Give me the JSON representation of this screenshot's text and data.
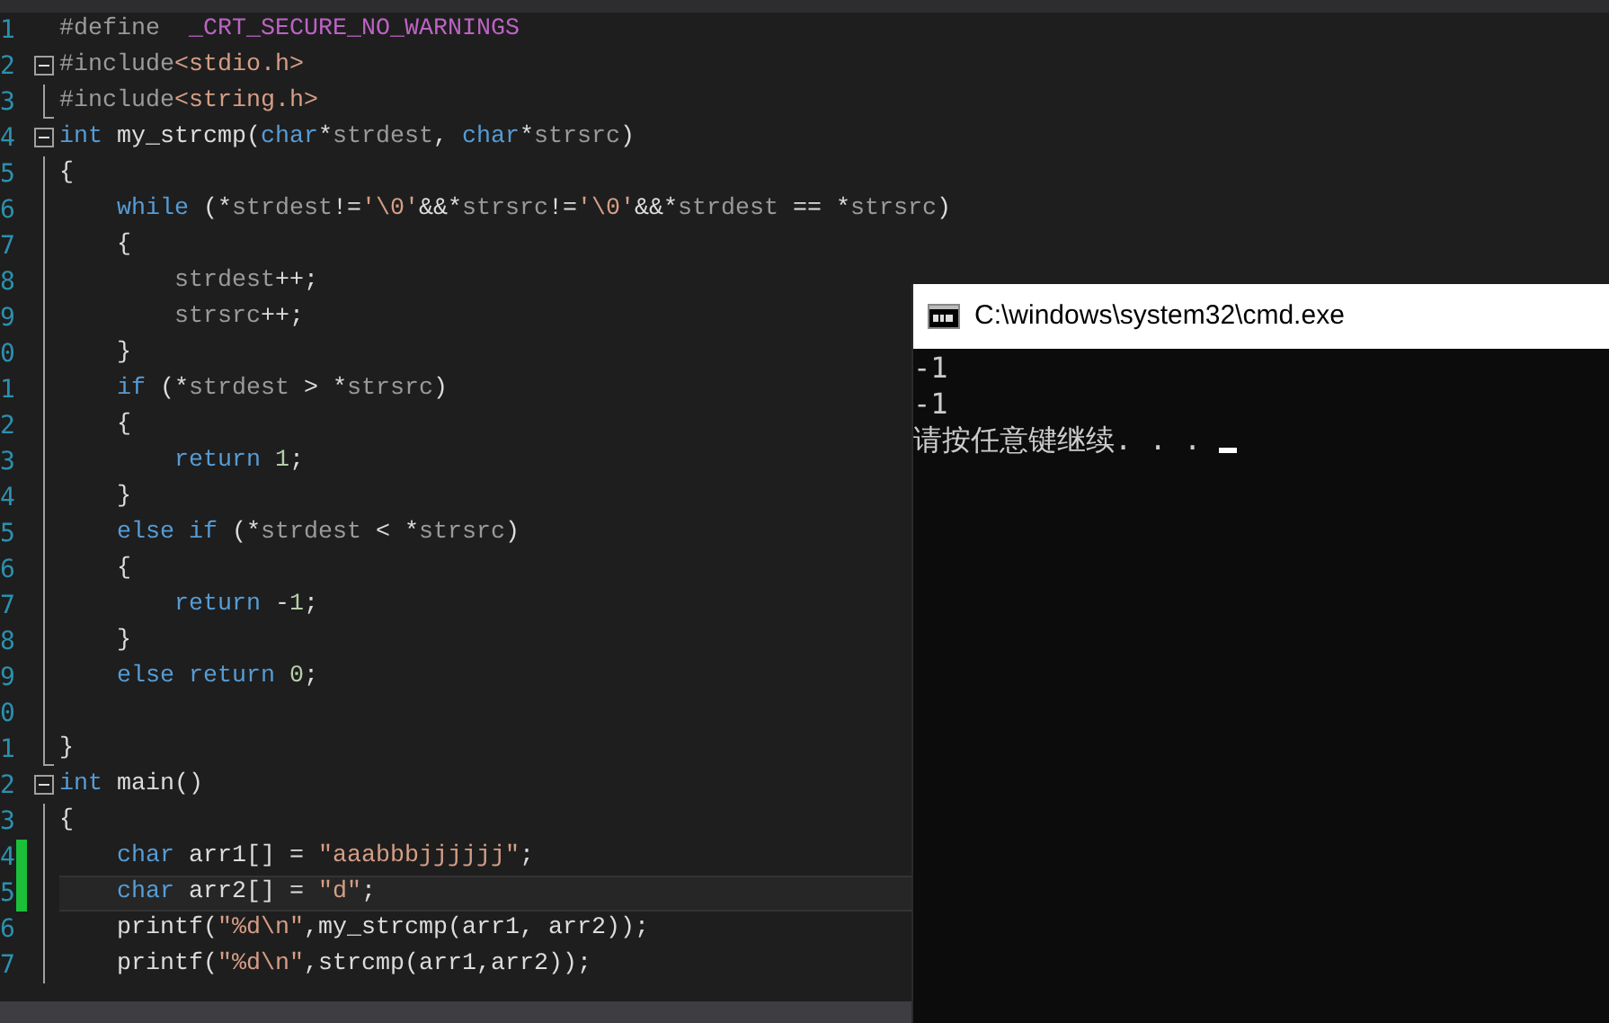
{
  "editor": {
    "lines": [
      {
        "number": "1",
        "kind": "flush",
        "tokens": [
          {
            "kind": "pre",
            "text": "#define"
          },
          {
            "kind": "macro",
            "text": "  _CRT_SECURE_NO_WARNINGS"
          }
        ]
      },
      {
        "number": "2",
        "kind": "flush",
        "collapsible": true,
        "tokens": [
          {
            "kind": "pre",
            "text": "#include"
          },
          {
            "kind": "string",
            "text": "<stdio.h>"
          }
        ]
      },
      {
        "number": "3",
        "kind": "flush",
        "block_end": true,
        "tokens": [
          {
            "kind": "pre",
            "text": "#include"
          },
          {
            "kind": "string",
            "text": "<string.h>"
          }
        ]
      },
      {
        "number": "4",
        "kind": "flush",
        "collapsible": true,
        "tokens": [
          {
            "kind": "keyword",
            "text": "int"
          },
          {
            "kind": "plain",
            "text": " my_strcmp("
          },
          {
            "kind": "keyword",
            "text": "char"
          },
          {
            "kind": "plain",
            "text": "*"
          },
          {
            "kind": "param",
            "text": "strdest"
          },
          {
            "kind": "plain",
            "text": ","
          },
          {
            "kind": "keyword",
            "text": " char"
          },
          {
            "kind": "plain",
            "text": "*"
          },
          {
            "kind": "param",
            "text": "strsrc"
          },
          {
            "kind": "plain",
            "text": ")"
          }
        ]
      },
      {
        "number": "5",
        "kind": "flush",
        "in_block": true,
        "tokens": [
          {
            "kind": "plain",
            "text": "{"
          }
        ]
      },
      {
        "number": "6",
        "kind": "indent1",
        "in_block": true,
        "tokens": [
          {
            "kind": "keyword",
            "text": "while"
          },
          {
            "kind": "plain",
            "text": " (*"
          },
          {
            "kind": "param",
            "text": "strdest"
          },
          {
            "kind": "plain",
            "text": "!="
          },
          {
            "kind": "string",
            "text": "'\\0'"
          },
          {
            "kind": "plain",
            "text": "&&*"
          },
          {
            "kind": "param",
            "text": "strsrc"
          },
          {
            "kind": "plain",
            "text": "!="
          },
          {
            "kind": "string",
            "text": "'\\0'"
          },
          {
            "kind": "plain",
            "text": "&&*"
          },
          {
            "kind": "param",
            "text": "strdest"
          },
          {
            "kind": "plain",
            "text": " == *"
          },
          {
            "kind": "param",
            "text": "strsrc"
          },
          {
            "kind": "plain",
            "text": ")"
          }
        ]
      },
      {
        "number": "7",
        "kind": "indent1",
        "in_block": true,
        "tokens": [
          {
            "kind": "plain",
            "text": "{"
          }
        ]
      },
      {
        "number": "8",
        "kind": "indent2",
        "in_block": true,
        "tokens": [
          {
            "kind": "param",
            "text": "strdest"
          },
          {
            "kind": "plain",
            "text": "++;"
          }
        ]
      },
      {
        "number": "9",
        "kind": "indent2",
        "in_block": true,
        "tokens": [
          {
            "kind": "param",
            "text": "strsrc"
          },
          {
            "kind": "plain",
            "text": "++;"
          }
        ]
      },
      {
        "number": "0",
        "kind": "indent1",
        "in_block": true,
        "tokens": [
          {
            "kind": "plain",
            "text": "}"
          }
        ]
      },
      {
        "number": "1",
        "kind": "indent1",
        "in_block": true,
        "tokens": [
          {
            "kind": "keyword",
            "text": "if"
          },
          {
            "kind": "plain",
            "text": " (*"
          },
          {
            "kind": "param",
            "text": "strdest"
          },
          {
            "kind": "plain",
            "text": " > *"
          },
          {
            "kind": "param",
            "text": "strsrc"
          },
          {
            "kind": "plain",
            "text": ")"
          }
        ]
      },
      {
        "number": "2",
        "kind": "indent1",
        "in_block": true,
        "tokens": [
          {
            "kind": "plain",
            "text": "{"
          }
        ]
      },
      {
        "number": "3",
        "kind": "indent2",
        "in_block": true,
        "tokens": [
          {
            "kind": "keyword",
            "text": "return"
          },
          {
            "kind": "number",
            "text": " 1"
          },
          {
            "kind": "plain",
            "text": ";"
          }
        ]
      },
      {
        "number": "4",
        "kind": "indent1",
        "in_block": true,
        "tokens": [
          {
            "kind": "plain",
            "text": "}"
          }
        ]
      },
      {
        "number": "5",
        "kind": "indent1",
        "in_block": true,
        "tokens": [
          {
            "kind": "keyword",
            "text": "else if"
          },
          {
            "kind": "plain",
            "text": " (*"
          },
          {
            "kind": "param",
            "text": "strdest"
          },
          {
            "kind": "plain",
            "text": " < *"
          },
          {
            "kind": "param",
            "text": "strsrc"
          },
          {
            "kind": "plain",
            "text": ")"
          }
        ]
      },
      {
        "number": "6",
        "kind": "indent1",
        "in_block": true,
        "tokens": [
          {
            "kind": "plain",
            "text": "{"
          }
        ]
      },
      {
        "number": "7",
        "kind": "indent2",
        "in_block": true,
        "tokens": [
          {
            "kind": "keyword",
            "text": "return"
          },
          {
            "kind": "plain",
            "text": " -"
          },
          {
            "kind": "number",
            "text": "1"
          },
          {
            "kind": "plain",
            "text": ";"
          }
        ]
      },
      {
        "number": "8",
        "kind": "indent1",
        "in_block": true,
        "tokens": [
          {
            "kind": "plain",
            "text": "}"
          }
        ]
      },
      {
        "number": "9",
        "kind": "indent1",
        "in_block": true,
        "tokens": [
          {
            "kind": "keyword",
            "text": "else return"
          },
          {
            "kind": "number",
            "text": " 0"
          },
          {
            "kind": "plain",
            "text": ";"
          }
        ]
      },
      {
        "number": "0",
        "kind": "flush",
        "in_block": true
      },
      {
        "number": "1",
        "kind": "flush",
        "block_end": true,
        "tokens": [
          {
            "kind": "plain",
            "text": "}"
          }
        ]
      },
      {
        "number": "2",
        "kind": "flush",
        "collapsible": true,
        "tokens": [
          {
            "kind": "keyword",
            "text": "int"
          },
          {
            "kind": "plain",
            "text": " main()"
          }
        ]
      },
      {
        "number": "3",
        "kind": "flush",
        "in_block": true,
        "tokens": [
          {
            "kind": "plain",
            "text": "{"
          }
        ]
      },
      {
        "number": "4",
        "kind": "indent1",
        "in_block": true,
        "changed": true,
        "tokens": [
          {
            "kind": "keyword",
            "text": "char"
          },
          {
            "kind": "plain",
            "text": " arr1[] = "
          },
          {
            "kind": "string",
            "text": "\"aaabbbjjjjjj\""
          },
          {
            "kind": "plain",
            "text": ";"
          }
        ]
      },
      {
        "number": "5",
        "kind": "indent1",
        "in_block": true,
        "changed": true,
        "current": true,
        "tokens": [
          {
            "kind": "keyword",
            "text": "char"
          },
          {
            "kind": "plain",
            "text": " arr2[] = "
          },
          {
            "kind": "string",
            "text": "\"d\""
          },
          {
            "kind": "plain",
            "text": ";"
          }
        ]
      },
      {
        "number": "6",
        "kind": "indent1",
        "in_block": true,
        "tokens": [
          {
            "kind": "plain",
            "text": "printf("
          },
          {
            "kind": "string",
            "text": "\"%d\\n\""
          },
          {
            "kind": "plain",
            "text": ",my_strcmp(arr1, arr2));"
          }
        ]
      },
      {
        "number": "7",
        "kind": "indent1",
        "in_block": true,
        "tokens": [
          {
            "kind": "plain",
            "text": "printf("
          },
          {
            "kind": "string",
            "text": "\"%d\\n\""
          },
          {
            "kind": "plain",
            "text": ",strcmp(arr1,arr2));"
          }
        ]
      }
    ]
  },
  "console": {
    "title": "C:\\windows\\system32\\cmd.exe",
    "lines": [
      "-1",
      "-1",
      "请按任意键继续. . ."
    ]
  }
}
